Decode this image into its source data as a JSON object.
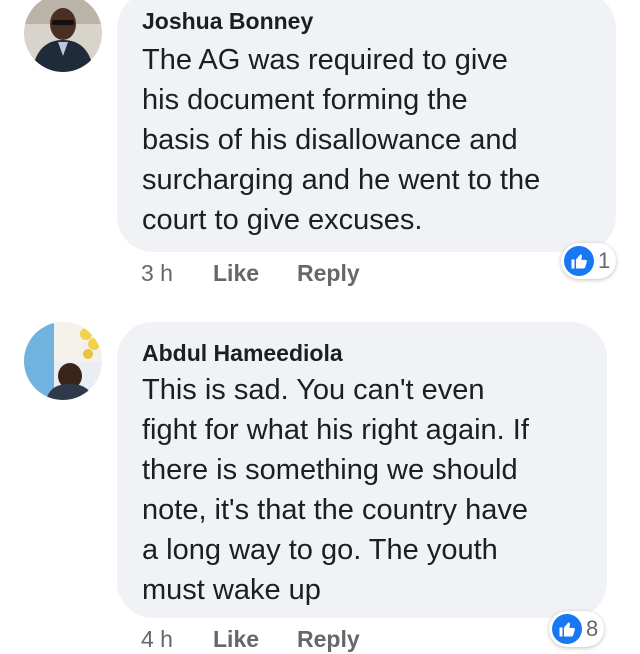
{
  "comments": [
    {
      "author": "Joshua Bonney",
      "text": "The AG was required to give\nhis document forming the\nbasis of his disallowance and\nsurcharging and he went to the\ncourt to give excuses.",
      "time": "3 h",
      "like_label": "Like",
      "reply_label": "Reply",
      "reaction_icon": "like-icon",
      "reaction_count": "1"
    },
    {
      "author": "Abdul Hameediola",
      "text": "This is sad. You can't even\nfight for what his right again. If\nthere is something we should\nnote, it's that the country have\na long way to go. The youth\nmust wake up",
      "time": "4 h",
      "like_label": "Like",
      "reply_label": "Reply",
      "reaction_icon": "like-icon",
      "reaction_count": "8"
    }
  ],
  "colors": {
    "bubble": "#f0f2f5",
    "text": "#1c1e21",
    "meta": "#65676b",
    "like_blue": "#1877f2"
  }
}
